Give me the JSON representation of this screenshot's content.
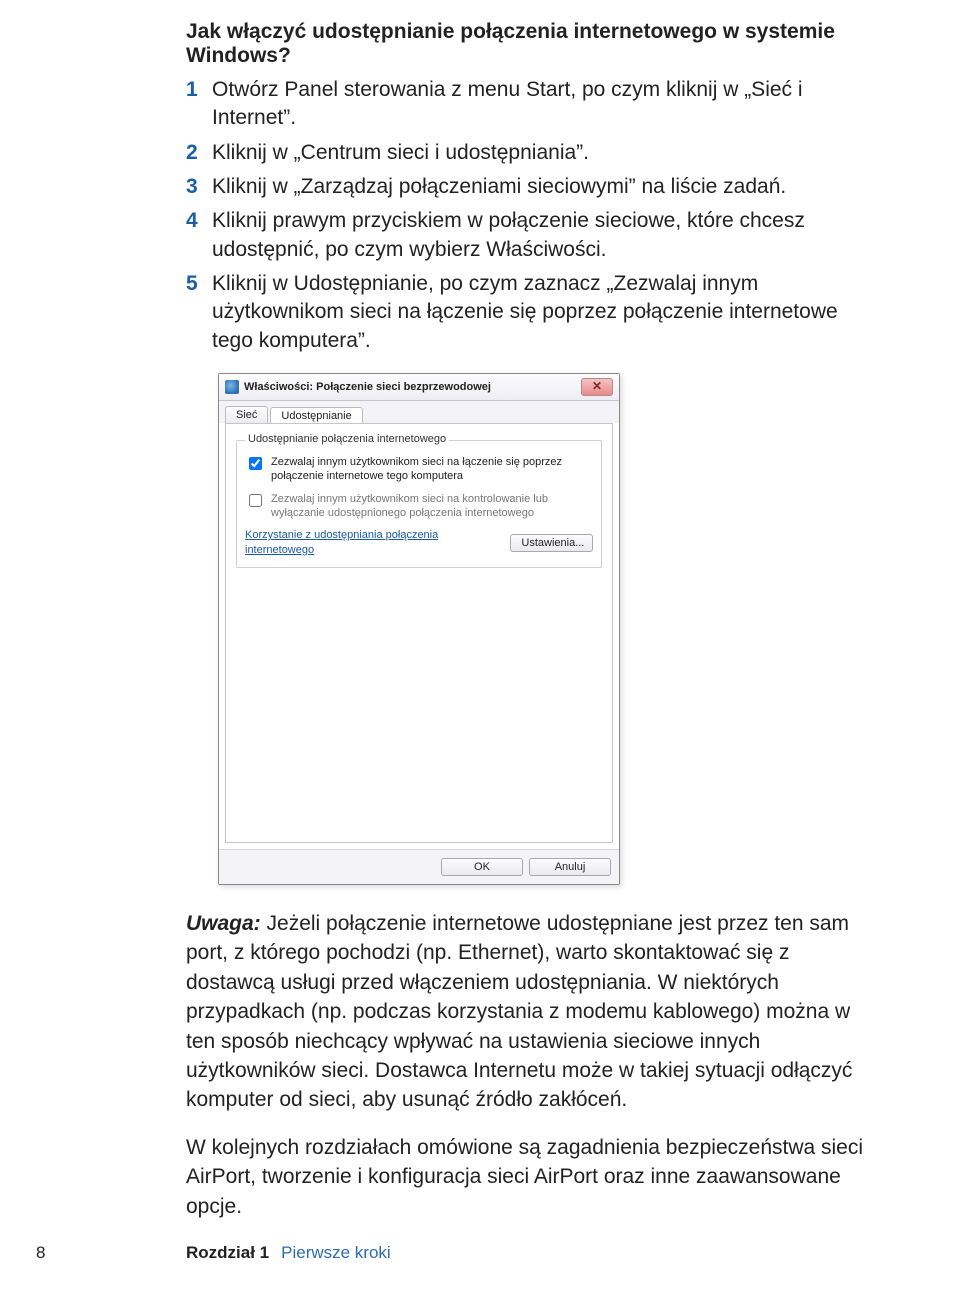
{
  "heading": "Jak włączyć udostępnianie połączenia internetowego w systemie Windows?",
  "steps": [
    {
      "n": "1",
      "t": "Otwórz Panel sterowania z menu Start, po czym kliknij w „Sieć i Internet”."
    },
    {
      "n": "2",
      "t": "Kliknij w „Centrum sieci i udostępniania”."
    },
    {
      "n": "3",
      "t": "Kliknij w „Zarządzaj połączeniami sieciowymi” na liście zadań."
    },
    {
      "n": "4",
      "t": "Kliknij prawym przyciskiem w połączenie sieciowe, które chcesz udostępnić, po czym wybierz Właściwości."
    },
    {
      "n": "5",
      "t": "Kliknij w Udostępnianie, po czym zaznacz „Zezwalaj innym użytkownikom sieci na łączenie się poprzez połączenie internetowe tego komputera”."
    }
  ],
  "dialog": {
    "title": "Właściwości: Połączenie sieci bezprzewodowej",
    "close_label": "✕",
    "tabs": {
      "network": "Sieć",
      "sharing": "Udostępnianie"
    },
    "group_legend": "Udostępnianie połączenia internetowego",
    "chk1": "Zezwalaj innym użytkownikom sieci na łączenie się poprzez połączenie internetowe tego komputera",
    "chk2": "Zezwalaj innym użytkownikom sieci na kontrolowanie lub wyłączanie udostępnionego połączenia internetowego",
    "link_text": "Korzystanie z udostępniania połączenia internetowego",
    "settings_btn": "Ustawienia...",
    "ok": "OK",
    "cancel": "Anuluj"
  },
  "note": {
    "label": "Uwaga:",
    "text": "Jeżeli połączenie internetowe udostępniane jest przez ten sam port, z którego pochodzi (np. Ethernet), warto skontaktować się z dostawcą usługi przed włączeniem udostępniania. W niektórych przypadkach (np. podczas korzystania z modemu kablowego) można w ten sposób niechcący wpływać na ustawienia sieciowe innych użytkowników sieci. Dostawca Internetu może w takiej sytuacji odłączyć komputer od sieci, aby usunąć źródło zakłóceń."
  },
  "paragraph": "W kolejnych rozdziałach omówione są zagadnienia bezpieczeństwa sieci AirPort, tworzenie i konfiguracja sieci AirPort oraz inne zaawansowane opcje.",
  "footer": {
    "page": "8",
    "chapter": "Rozdział 1",
    "chapter_name": "Pierwsze kroki"
  }
}
